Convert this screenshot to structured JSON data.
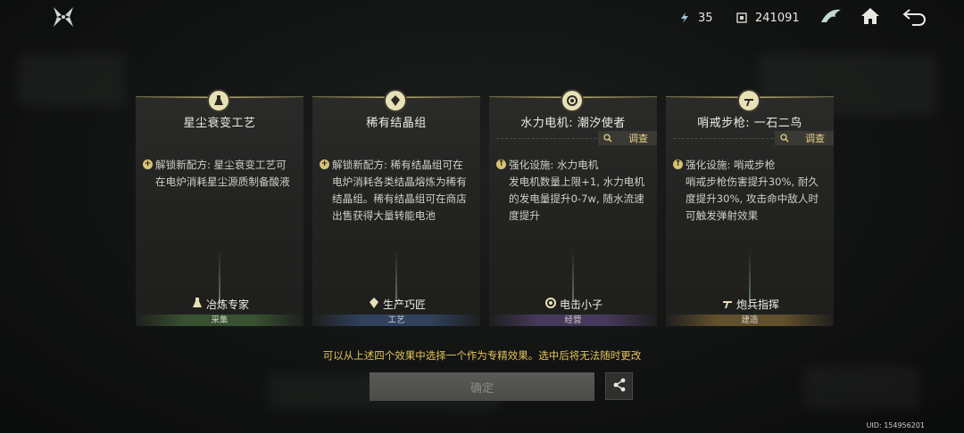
{
  "resources": {
    "energy": "35",
    "currency": "241091"
  },
  "cards": [
    {
      "title": "星尘衰变工艺",
      "desc": "解锁新配方: 星尘衰变工艺可在电炉消耗星尘源质制备酸液",
      "trait": "冶炼专家",
      "category": "采集",
      "icon": "flask-icon"
    },
    {
      "title": "稀有结晶组",
      "desc": "解锁新配方: 稀有结晶组可在电炉消耗各类结晶熔炼为稀有结晶组。稀有结晶组可在商店出售获得大量转能电池",
      "trait": "生产巧匠",
      "category": "工艺",
      "icon": "crystal-icon"
    },
    {
      "title": "水力电机: 潮汐使者",
      "probe": "调查",
      "desc": "强化设施: 水力电机\n发电机数量上限+1, 水力电机的发电量提升0-7w, 随水流速度提升",
      "trait": "电击小子",
      "category": "经营",
      "icon": "generator-icon"
    },
    {
      "title": "哨戒步枪: 一石二鸟",
      "probe": "调查",
      "desc": "强化设施: 哨戒步枪\n哨戒步枪伤害提升30%, 耐久度提升30%, 攻击命中敌人时可触发弹射效果",
      "trait": "炮兵指挥",
      "category": "建造",
      "icon": "turret-icon"
    }
  ],
  "notice": "可以从上述四个效果中选择一个作为专精效果。选中后将无法随时更改",
  "confirm_label": "确定",
  "uid": "UID: 154956201",
  "colors": {
    "gold": "#e6c35a",
    "green": "#466e3c",
    "blue": "#375078",
    "purple": "#584478",
    "amber": "#786032"
  }
}
